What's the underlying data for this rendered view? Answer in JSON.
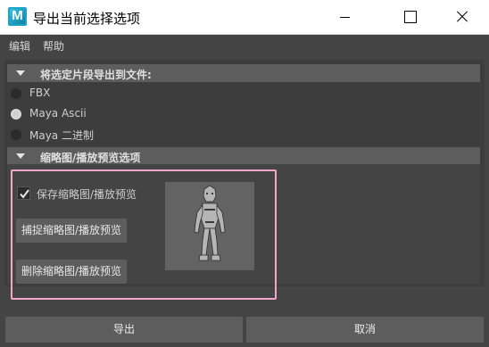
{
  "window": {
    "app_icon_letter": "M",
    "title": "导出当前选择选项"
  },
  "menu": {
    "items": [
      "编辑",
      "帮助"
    ]
  },
  "export_section": {
    "title": "将选定片段导出到文件:",
    "options": [
      {
        "label": "FBX",
        "selected": false
      },
      {
        "label": "Maya Ascii",
        "selected": true
      },
      {
        "label": "Maya 二进制",
        "selected": false
      }
    ]
  },
  "thumbnail_section": {
    "title": "缩略图/播放预览选项",
    "save_checkbox_label": "保存缩略图/播放预览",
    "save_checked": true,
    "capture_button": "捕捉缩略图/播放预览",
    "delete_button": "删除缩略图/播放预览"
  },
  "footer": {
    "export_button": "导出",
    "cancel_button": "取消"
  },
  "colors": {
    "highlight_border": "#f2a6c9",
    "app_icon": "#1aa5c8"
  }
}
